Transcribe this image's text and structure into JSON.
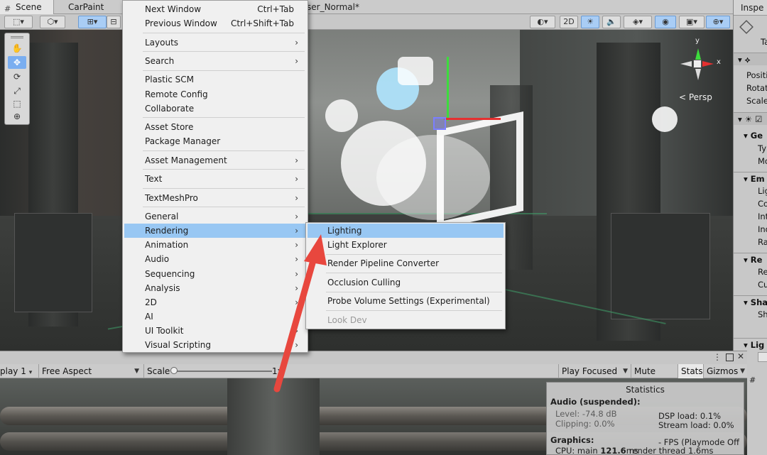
{
  "tabs": {
    "scene": "Scene",
    "carpaint": "CarPaint",
    "doc_title": "ser_Normal*"
  },
  "scene_toolbar": {
    "mode_2d": "2D"
  },
  "scene_overlay": {
    "persp_label": "< Persp",
    "axis_y": "y",
    "axis_x": "x"
  },
  "main_menu": {
    "items": [
      {
        "label": "Next Window",
        "shortcut": "Ctrl+Tab"
      },
      {
        "label": "Previous Window",
        "shortcut": "Ctrl+Shift+Tab"
      },
      {
        "label": "Layouts"
      },
      {
        "label": "Search"
      },
      {
        "label": "Plastic SCM"
      },
      {
        "label": "Remote Config"
      },
      {
        "label": "Collaborate"
      },
      {
        "label": "Asset Store"
      },
      {
        "label": "Package Manager"
      },
      {
        "label": "Asset Management"
      },
      {
        "label": "Text"
      },
      {
        "label": "TextMeshPro"
      },
      {
        "label": "General"
      },
      {
        "label": "Rendering"
      },
      {
        "label": "Animation"
      },
      {
        "label": "Audio"
      },
      {
        "label": "Sequencing"
      },
      {
        "label": "Analysis"
      },
      {
        "label": "2D"
      },
      {
        "label": "AI"
      },
      {
        "label": "UI Toolkit"
      },
      {
        "label": "Visual Scripting"
      }
    ]
  },
  "rendering_submenu": {
    "items": [
      {
        "label": "Lighting"
      },
      {
        "label": "Light Explorer"
      },
      {
        "label": "Render Pipeline Converter"
      },
      {
        "label": "Occlusion Culling"
      },
      {
        "label": "Probe Volume Settings (Experimental)"
      },
      {
        "label": "Look Dev"
      }
    ]
  },
  "inspector": {
    "tab": "Inspe",
    "tag": "Ta",
    "rows": [
      "Positi",
      "Rotati",
      "Scale",
      "Ge",
      "Ty",
      "Mo",
      "Em",
      "Lig",
      "Co",
      "Int",
      "Ind",
      "Ra",
      "Re",
      "Re",
      "Cu",
      "Sha",
      "Sh",
      "Lig"
    ]
  },
  "game_toolbar": {
    "display": "play 1",
    "aspect": "Free Aspect",
    "scale_label": "Scale",
    "scale_value": "1x",
    "play_focused": "Play Focused",
    "mute_audio": "Mute Audio",
    "stats": "Stats",
    "gizmos": "Gizmos"
  },
  "statistics": {
    "title": "Statistics",
    "audio_header": "Audio (suspended):",
    "level": "Level: -74.8 dB",
    "clipping": "Clipping: 0.0%",
    "dsp_load": "DSP load: 0.1%",
    "stream_load": "Stream load: 0.0%",
    "graphics_header": "Graphics:",
    "fps": "- FPS (Playmode Off",
    "cpu_prefix": "CPU: main",
    "cpu_main": "121.6",
    "cpu_unit": "ms",
    "render_thread": "render thread 1.6ms"
  },
  "colors": {
    "menu_highlight": "#98c7f3",
    "arrow": "#e8473e",
    "accent_blue": "#7aaef0"
  }
}
